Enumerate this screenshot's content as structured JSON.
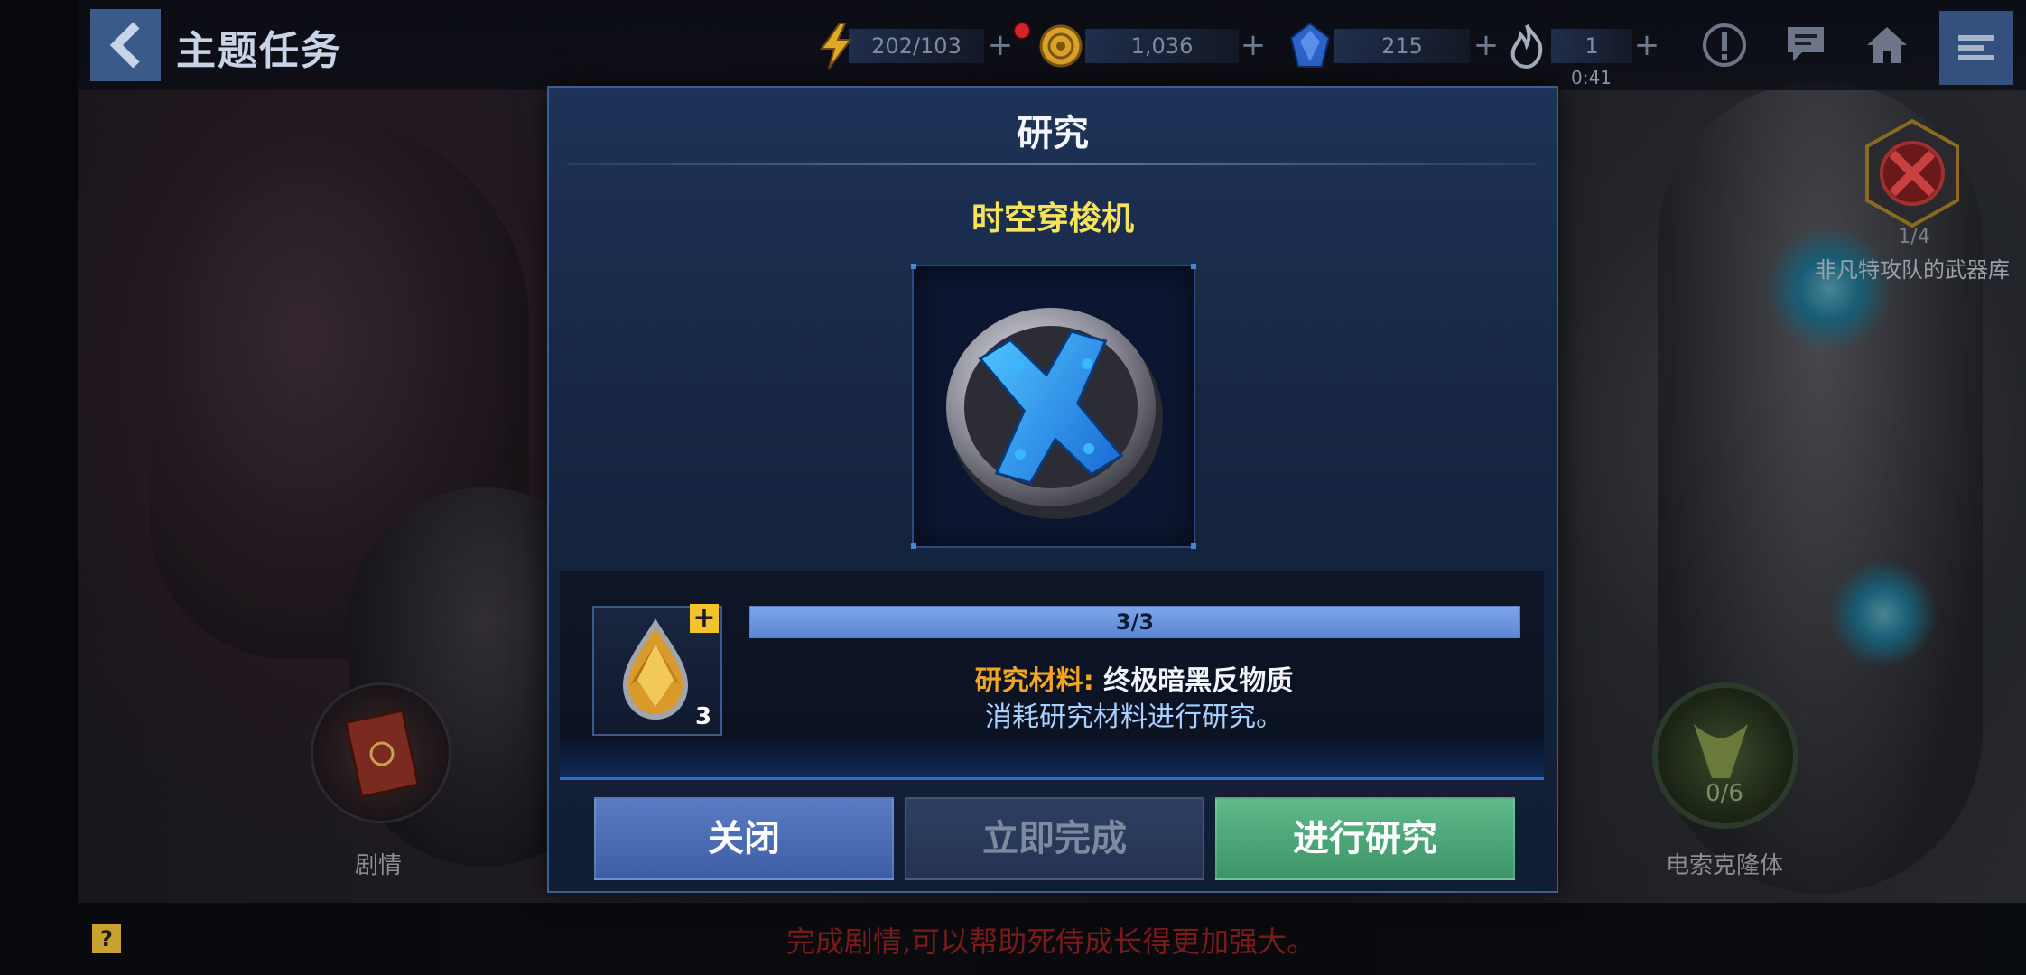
{
  "header": {
    "title": "主题任务",
    "energy": "202/103",
    "coins": "1,036",
    "crystals": "215",
    "stamina": "1",
    "stamina_timer": "0:41"
  },
  "side": {
    "right_badge_count": "1/4",
    "right_badge_label": "非凡特攻队的武器库",
    "bottom_left_label": "剧情",
    "bottom_right_count": "0/6",
    "bottom_right_label": "电索克隆体"
  },
  "footer": {
    "hint_icon": "?",
    "hint_text": "完成剧情,可以帮助死侍成长得更加强大。"
  },
  "dialog": {
    "title": "研究",
    "item_name": "时空穿梭机",
    "material": {
      "progress_text": "3/3",
      "progress_fraction": 1.0,
      "count": "3",
      "plus": "+",
      "label_key": "研究材料:",
      "label_value": "终极暗黑反物质",
      "description": "消耗研究材料进行研究。"
    },
    "buttons": {
      "close": "关闭",
      "instant": "立即完成",
      "research": "进行研究"
    }
  },
  "colors": {
    "accent_yellow": "#f7e35a",
    "material_orange": "#f3a526",
    "progress_blue": "#6e96de",
    "research_green": "#4aa878",
    "close_blue": "#4c6db4"
  },
  "icons": [
    "back-arrow-icon",
    "lightning-icon",
    "coin-icon",
    "crystal-icon",
    "flame-icon",
    "alert-icon",
    "chat-icon",
    "home-icon",
    "menu-icon",
    "x-emblem-icon",
    "anti-matter-gem-icon"
  ]
}
